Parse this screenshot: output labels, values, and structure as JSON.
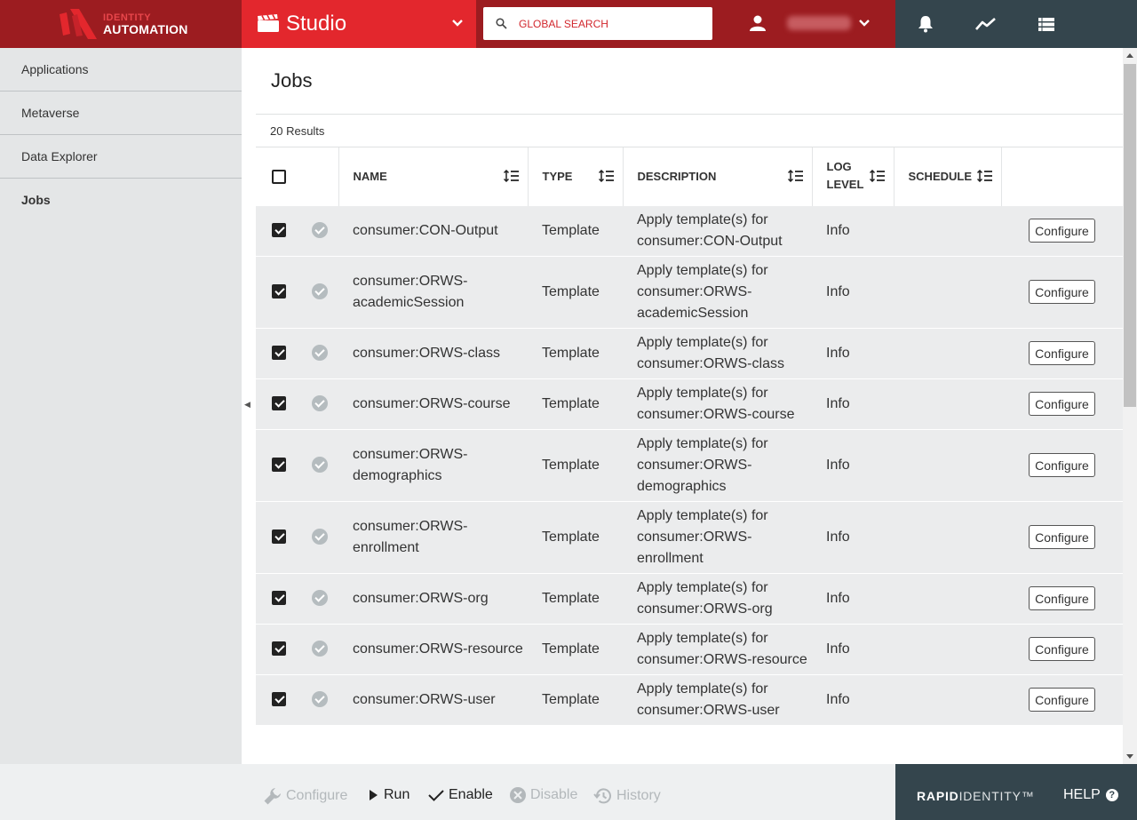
{
  "header": {
    "logo_line1": "IDENTITY",
    "logo_line2": "AUTOMATION",
    "app_title": "Studio",
    "search_placeholder": "GLOBAL SEARCH",
    "user_name": "",
    "tools": [
      "bell-icon",
      "activity-icon",
      "list-icon"
    ]
  },
  "sidebar": {
    "items": [
      {
        "label": "Applications",
        "active": false
      },
      {
        "label": "Metaverse",
        "active": false
      },
      {
        "label": "Data Explorer",
        "active": false
      },
      {
        "label": "Jobs",
        "active": true
      }
    ]
  },
  "main": {
    "title": "Jobs",
    "results": "20 Results",
    "columns": [
      "NAME",
      "TYPE",
      "DESCRIPTION",
      "LOG LEVEL",
      "SCHEDULE"
    ],
    "configure_label": "Configure",
    "rows": [
      {
        "name": "consumer:CON-Output",
        "type": "Template",
        "description": "Apply template(s) for consumer:CON-Output",
        "log_level": "Info",
        "schedule": ""
      },
      {
        "name": "consumer:ORWS-academicSession",
        "type": "Template",
        "description": "Apply template(s) for consumer:ORWS-academicSession",
        "log_level": "Info",
        "schedule": ""
      },
      {
        "name": "consumer:ORWS-class",
        "type": "Template",
        "description": "Apply template(s) for consumer:ORWS-class",
        "log_level": "Info",
        "schedule": ""
      },
      {
        "name": "consumer:ORWS-course",
        "type": "Template",
        "description": "Apply template(s) for consumer:ORWS-course",
        "log_level": "Info",
        "schedule": ""
      },
      {
        "name": "consumer:ORWS-demographics",
        "type": "Template",
        "description": "Apply template(s) for consumer:ORWS-demographics",
        "log_level": "Info",
        "schedule": ""
      },
      {
        "name": "consumer:ORWS-enrollment",
        "type": "Template",
        "description": "Apply template(s) for consumer:ORWS-enrollment",
        "log_level": "Info",
        "schedule": ""
      },
      {
        "name": "consumer:ORWS-org",
        "type": "Template",
        "description": "Apply template(s) for consumer:ORWS-org",
        "log_level": "Info",
        "schedule": ""
      },
      {
        "name": "consumer:ORWS-resource",
        "type": "Template",
        "description": "Apply template(s) for consumer:ORWS-resource",
        "log_level": "Info",
        "schedule": ""
      },
      {
        "name": "consumer:ORWS-user",
        "type": "Template",
        "description": "Apply template(s) for consumer:ORWS-user",
        "log_level": "Info",
        "schedule": ""
      }
    ]
  },
  "footer": {
    "actions": [
      {
        "label": "Configure",
        "icon": "wrench-icon",
        "enabled": false
      },
      {
        "label": "Run",
        "icon": "play-icon",
        "enabled": true
      },
      {
        "label": "Enable",
        "icon": "check-icon",
        "enabled": true
      },
      {
        "label": "Disable",
        "icon": "disable-icon",
        "enabled": false
      },
      {
        "label": "History",
        "icon": "history-icon",
        "enabled": false
      }
    ],
    "brand_bold": "RAPID",
    "brand_light": "IDENTITY™",
    "help": "HELP"
  },
  "colors": {
    "brand_dark_red": "#9c1c20",
    "brand_red": "#e3272d",
    "slate": "#34454d"
  }
}
